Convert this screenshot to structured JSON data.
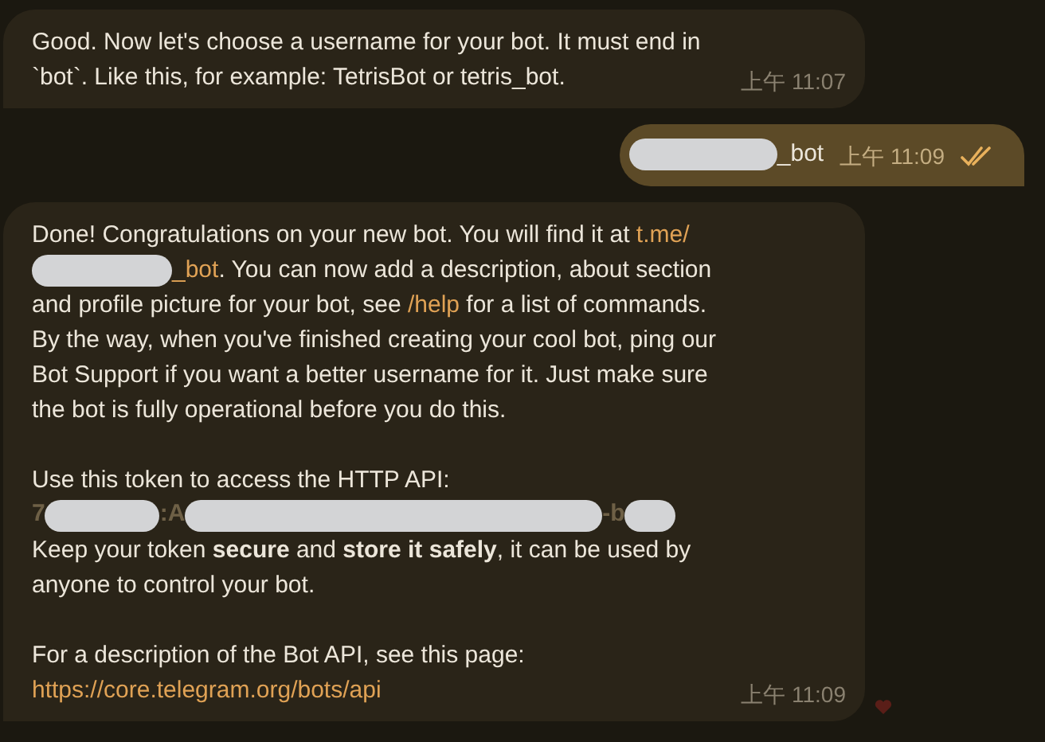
{
  "messages": [
    {
      "kind": "incoming",
      "time": "上午 11:07",
      "paragraphs": [
        [
          {
            "kind": "text",
            "text": "Good. Now let's choose a username for your bot. It must end in `bot`. Like this, for example: TetrisBot or tetris_bot."
          }
        ]
      ]
    },
    {
      "kind": "outgoing",
      "time": "上午 11:09",
      "read": true,
      "paragraphs": [
        [
          {
            "kind": "redacted"
          },
          {
            "kind": "text",
            "text": "_bot"
          }
        ]
      ]
    },
    {
      "kind": "incoming",
      "time": "上午 11:09",
      "heart": true,
      "paragraphs": [
        [
          {
            "kind": "text",
            "text": "Done! Congratulations on your new bot. You will find it at "
          },
          {
            "kind": "link",
            "text": "t.me/"
          },
          {
            "kind": "redacted"
          },
          {
            "kind": "link",
            "text": "_bot"
          },
          {
            "kind": "text",
            "text": ". You can now add a description, about section and profile picture for your bot, see "
          },
          {
            "kind": "link",
            "text": "/help"
          },
          {
            "kind": "text",
            "text": " for a list of commands. By the way, when you've finished creating your cool bot, ping our Bot Support if you want a better username for it. Just make sure the bot is fully operational before you do this."
          }
        ],
        [
          {
            "kind": "text",
            "text": "Use this token to access the HTTP API:"
          }
        ],
        [
          {
            "kind": "code",
            "text": "7"
          },
          {
            "kind": "redacted"
          },
          {
            "kind": "code",
            "text": ":A"
          },
          {
            "kind": "redacted"
          },
          {
            "kind": "code",
            "text": "-b"
          },
          {
            "kind": "redacted"
          }
        ],
        [
          {
            "kind": "text",
            "text": "Keep your token **secure** and **store it safely**, it can be used by anyone to control your bot."
          }
        ],
        [
          {
            "kind": "text",
            "text": "For a description of the Bot API, see this page: "
          },
          {
            "kind": "link",
            "text": "https://core.telegram.org/bots/api"
          }
        ]
      ]
    }
  ]
}
